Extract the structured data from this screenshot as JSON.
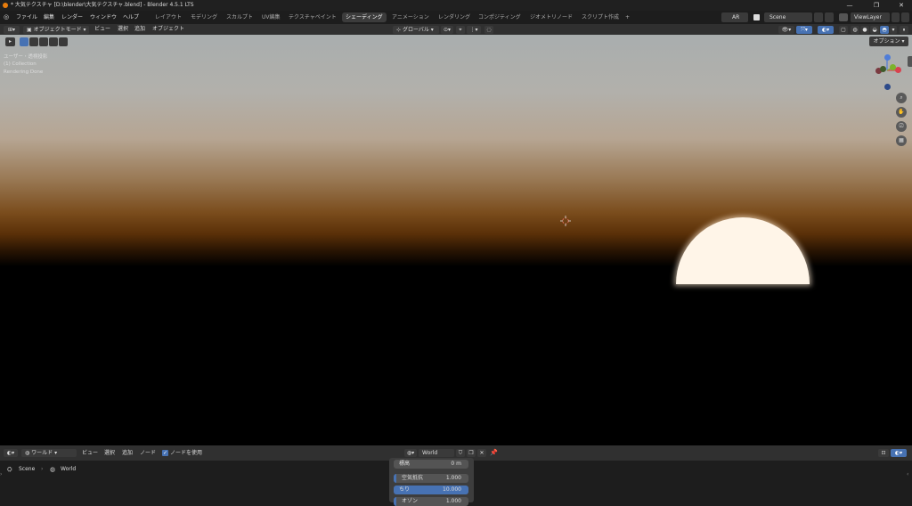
{
  "titlebar": {
    "title": "* 大気テクスチャ [D:\\blender\\大気テクスチャ.blend] - Blender 4.5.1 LTS",
    "min": "—",
    "max": "❐",
    "close": "✕"
  },
  "menu": {
    "items": [
      "ファイル",
      "編集",
      "レンダー",
      "ウィンドウ",
      "ヘルプ"
    ]
  },
  "workspaces": [
    "レイアウト",
    "モデリング",
    "スカルプト",
    "UV編集",
    "テクスチャペイント",
    "シェーディング",
    "アニメーション",
    "レンダリング",
    "コンポジティング",
    "ジオメトリノード",
    "スクリプト作成"
  ],
  "workspace_add": "+",
  "top_right": {
    "ar": "AR",
    "scene": "Scene",
    "viewlayer": "ViewLayer"
  },
  "viewport_header": {
    "mode": "オブジェクトモード",
    "menu": [
      "ビュー",
      "選択",
      "追加",
      "オブジェクト"
    ],
    "transform": "グローバル",
    "options": "オプション"
  },
  "viewport": {
    "view_name": "ユーザー・透視投影",
    "collection": "(1) Collection",
    "status": "Rendering Done"
  },
  "gizmo": {
    "x": "X",
    "y": "Y",
    "z": "Z"
  },
  "node_header": {
    "type": "ワールド",
    "menu": [
      "ビュー",
      "選択",
      "追加",
      "ノード"
    ],
    "use_nodes": "ノードを使用",
    "world_name": "World"
  },
  "breadcrumb": {
    "scene": "Scene",
    "world": "World"
  },
  "sky_panel": {
    "altitude_label": "標高",
    "altitude_value": "0 m",
    "air_label": "空気抵抗",
    "air_value": "1.000",
    "dust_label": "ちり",
    "dust_value": "10.000",
    "ozone_label": "オゾン",
    "ozone_value": "1.000"
  },
  "colors": {
    "accent": "#4772b3",
    "header": "#303030",
    "background": "#1d1d1d"
  }
}
